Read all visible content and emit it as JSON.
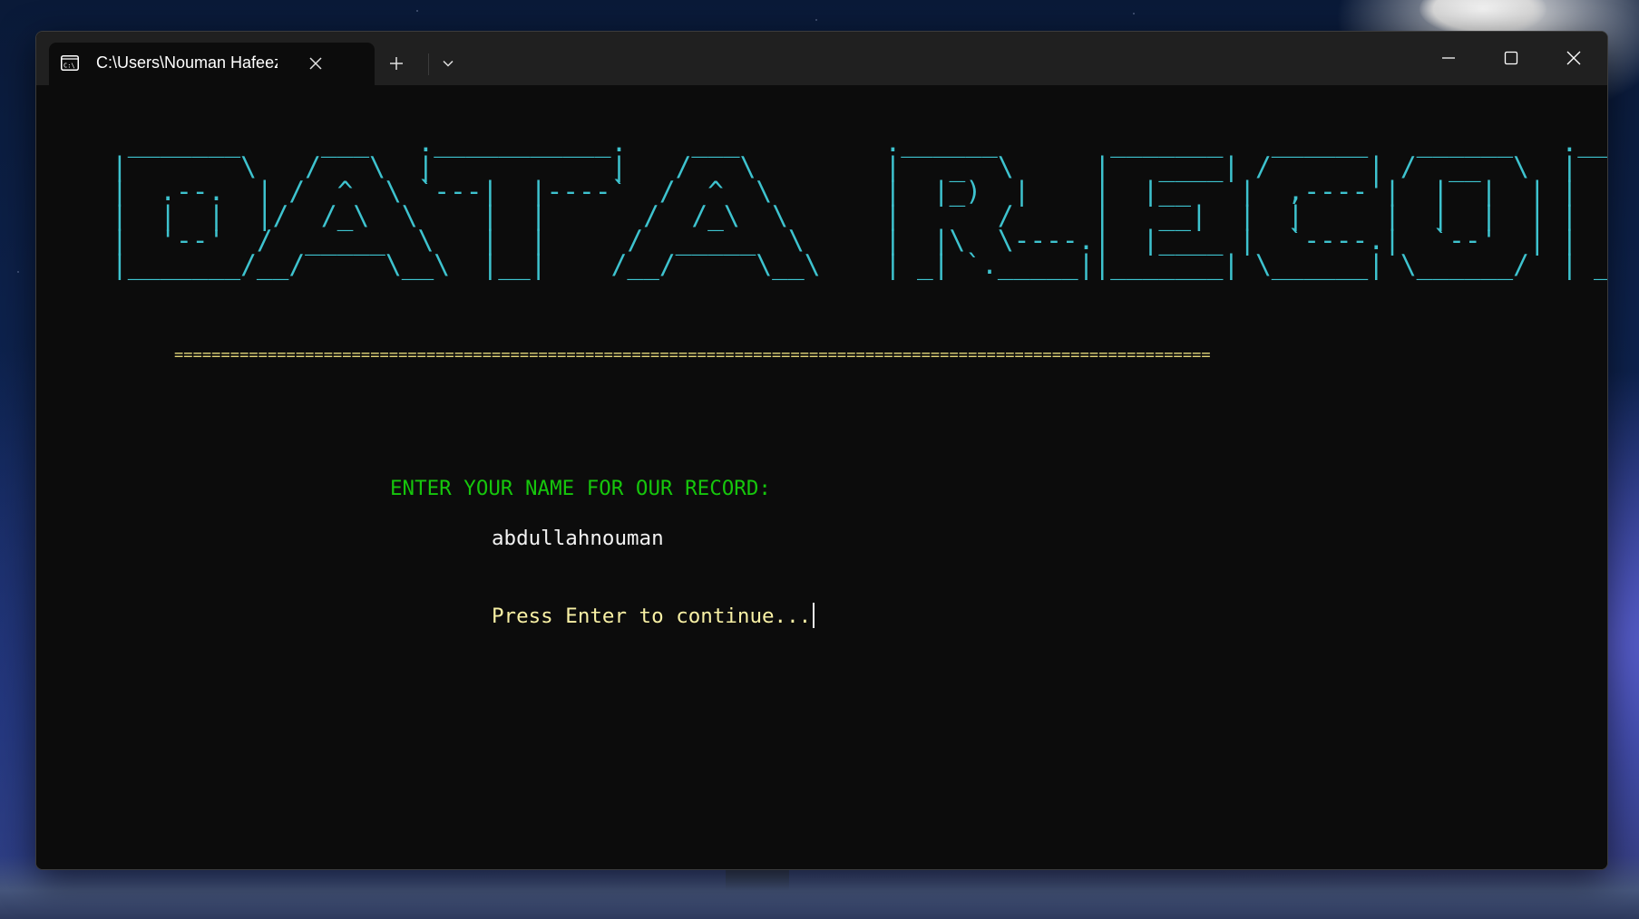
{
  "window": {
    "tab_title": "C:\\Users\\Nouman Hafeez\\Des",
    "tab_icon": "terminal-icon",
    "close_tab_icon": "close-icon",
    "new_tab_icon": "plus-icon",
    "dropdown_icon": "chevron-down-icon",
    "minimize_icon": "minimize-icon",
    "maximize_icon": "maximize-icon",
    "close_window_icon": "close-icon"
  },
  "terminal": {
    "banner_lines": [
      " _______     ___   .___________.    ___         .______       _______   ______   ______   .______       _______  ",
      "|       \\   /   \\  |           |   /   \\        |   _  \\     |   ____| /      | /  __  \\  |   _  \\     |       \\ ",
      "|  .--.  | /  ^  \\ `---|  |----`  /  ^  \\       |  |_)  |    |  |__   |  ,----'|  |  |  | |  |_)  |    |  .--.  |",
      "|  |  |  |/  /_\\  \\    |  |      /  /_\\  \\      |      /     |   __|  |  |     |  |  |  | |      /     |  |  |  |",
      "|  '--'  /  _____  \\   |  |     /  _____  \\     |  |\\  \\----.|  |____ |  `----.|  `--'  | |  |\\  \\----.|  '--'  |",
      "|_______/__/     \\__\\  |__|    /__/     \\__\\    | _| `._____||_______| \\______| \\______/  | _| `._____||_______/ "
    ],
    "separator": "===============================================================================================================",
    "prompt": "ENTER YOUR NAME FOR OUR RECORD:",
    "input_value": "abdullahnouman",
    "continue_text": "Press Enter to continue...",
    "colors": {
      "banner": "#3ec3cf",
      "separator": "#e3d77a",
      "prompt": "#16c60c",
      "input": "#f2f2f2",
      "continue": "#f9f1a5",
      "background": "#0c0c0c"
    }
  }
}
